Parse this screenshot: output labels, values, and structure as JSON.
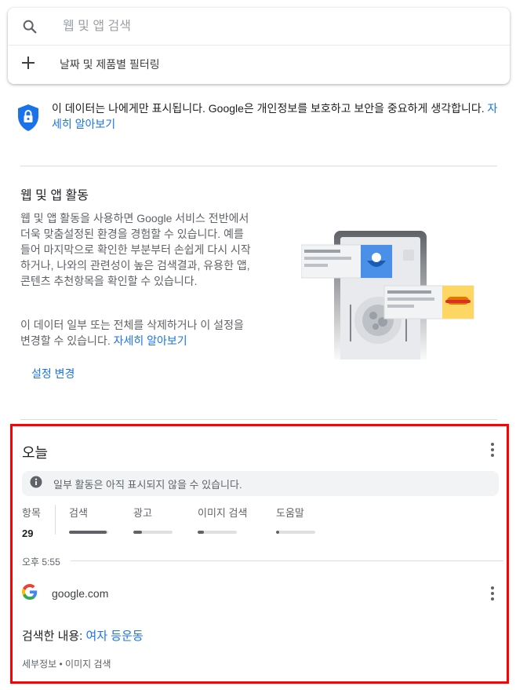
{
  "search": {
    "placeholder": "웹 및 앱 검색",
    "filter_label": "날짜 및 제품별 필터링"
  },
  "privacy": {
    "text": "이 데이터는 나에게만 표시됩니다. Google은 개인정보를 보호하고 보안을 중요하게 생각합니다.",
    "link": "자세히 알아보기"
  },
  "activity": {
    "title": "웹 및 앱 활동",
    "description": "웹 및 앱 활동을 사용하면 Google 서비스 전반에서 더욱 맞춤설정된 환경을 경험할 수 있습니다. 예를 들어 마지막으로 확인한 부분부터 손쉽게 다시 시작하거나, 나와의 관련성이 높은 검색결과, 유용한 앱, 콘텐츠 추천항목을 확인할 수 있습니다.",
    "delete_text": "이 데이터 일부 또는 전체를 삭제하거나 이 설정을 변경할 수 있습니다.",
    "delete_link": "자세히 알아보기",
    "settings_button": "설정 변경"
  },
  "today": {
    "title": "오늘",
    "notice": "일부 활동은 아직 표시되지 않을 수 있습니다.",
    "total_label": "항목",
    "total_count": "29",
    "stats": [
      {
        "label": "검색",
        "fraction": 0.95
      },
      {
        "label": "광고",
        "fraction": 0.22
      },
      {
        "label": "이미지 검색",
        "fraction": 0.15
      },
      {
        "label": "도움말",
        "fraction": 0.08
      }
    ],
    "time": "오후 5:55",
    "site": "google.com",
    "query_label": "검색한 내용: ",
    "query_text": "여자 등운동",
    "meta": "세부정보 • 이미지 검색"
  },
  "colors": {
    "accent": "#1a73e8",
    "highlight_border": "#ff0000",
    "shield": "#1a73e8"
  },
  "icons": [
    "search-icon",
    "plus-icon",
    "shield-lock-icon",
    "info-icon",
    "more-vert-icon",
    "google-g-icon"
  ]
}
